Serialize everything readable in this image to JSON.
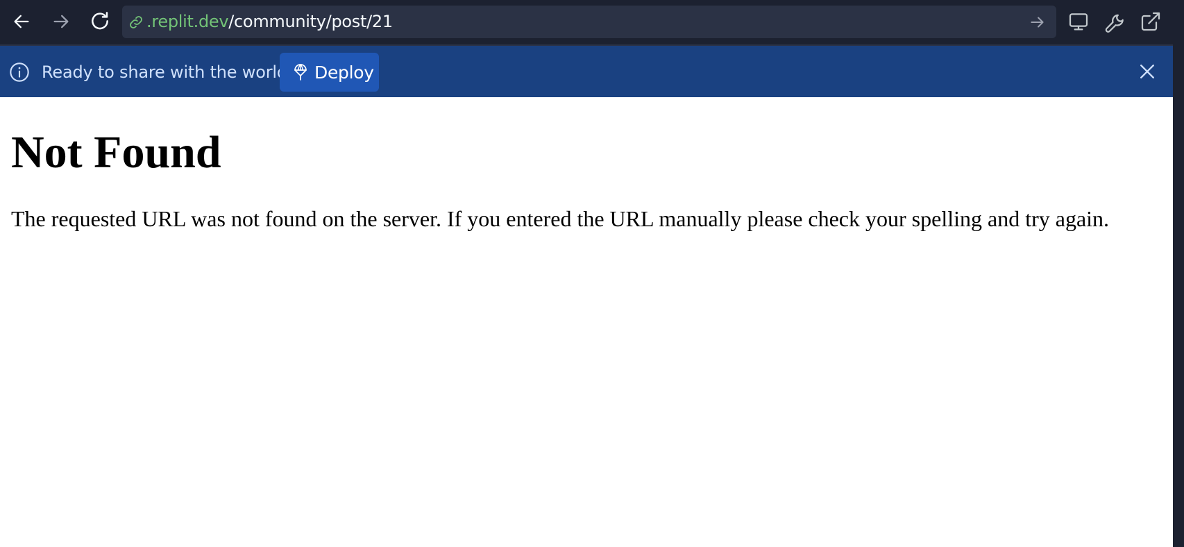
{
  "browser": {
    "url_domain": ".replit.dev",
    "url_path": "/community/post/21",
    "icons": [
      "back-arrow-icon",
      "forward-arrow-icon",
      "reload-icon",
      "link-icon",
      "go-arrow-icon",
      "monitor-icon",
      "wrench-icon",
      "external-link-icon"
    ]
  },
  "banner": {
    "message": "Ready to share with the world?",
    "deploy_label": "Deploy",
    "icons": [
      "info-icon",
      "deploy-icon",
      "close-icon"
    ]
  },
  "page": {
    "title": "Not Found",
    "message": "The requested URL was not found on the server. If you entered the URL manually please check your spelling and try again."
  },
  "colors": {
    "toolbar_bg": "#1c2130",
    "url_bar_bg": "#2b3245",
    "url_domain": "#73c377",
    "banner_bg": "#1a4181",
    "deploy_button_bg": "#2057b5",
    "page_bg": "#ffffff"
  }
}
